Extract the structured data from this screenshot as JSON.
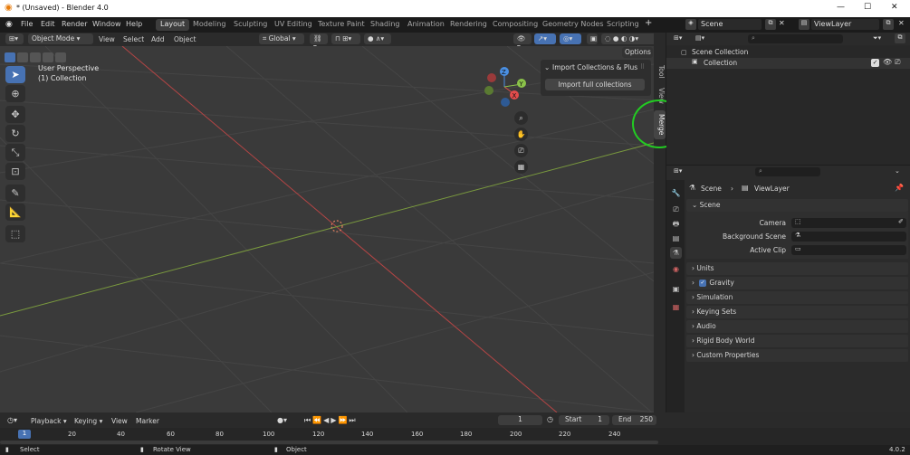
{
  "window": {
    "title": "* (Unsaved) - Blender 4.0",
    "minimize": "—",
    "maximize": "☐",
    "close": "✕"
  },
  "menu": [
    "File",
    "Edit",
    "Render",
    "Window",
    "Help"
  ],
  "workspaces": [
    "Layout",
    "Modeling",
    "Sculpting",
    "UV Editing",
    "Texture Paint",
    "Shading",
    "Animation",
    "Rendering",
    "Compositing",
    "Geometry Nodes",
    "Scripting"
  ],
  "active_workspace": "Layout",
  "add_tab": "+",
  "scene_field": "Scene",
  "viewlayer_field": "ViewLayer",
  "viewport_header": {
    "mode": "Object Mode",
    "menus": [
      "View",
      "Select",
      "Add",
      "Object"
    ],
    "orientation": "Global",
    "options": "Options"
  },
  "viewport": {
    "perspective": "User Perspective",
    "collection": "(1) Collection"
  },
  "gizmo": {
    "z": "Z",
    "y": "Y",
    "x": "X"
  },
  "sidebar_tabs": [
    "Tool",
    "View",
    "Merge"
  ],
  "import_panel": {
    "title": "Import Collections & Plus",
    "button": "Import full collections"
  },
  "outliner": {
    "scene_collection": "Scene Collection",
    "collection": "Collection"
  },
  "properties": {
    "breadcrumb_scene": "Scene",
    "breadcrumb_viewlayer": "ViewLayer",
    "scene_panel": "Scene",
    "camera_label": "Camera",
    "background_label": "Background Scene",
    "clip_label": "Active Clip",
    "panels": [
      "Units",
      "Gravity",
      "Simulation",
      "Keying Sets",
      "Audio",
      "Rigid Body World",
      "Custom Properties"
    ]
  },
  "timeline": {
    "menus": [
      "Playback",
      "Keying",
      "View",
      "Marker"
    ],
    "current_frame": "1",
    "start_label": "Start",
    "start_value": "1",
    "end_label": "End",
    "end_value": "250",
    "ruler": [
      "1",
      "20",
      "40",
      "60",
      "80",
      "100",
      "120",
      "140",
      "160",
      "180",
      "200",
      "220",
      "240"
    ]
  },
  "statusbar": {
    "select": "Select",
    "rotate": "Rotate View",
    "object": "Object",
    "version": "4.0.2"
  },
  "colors": {
    "accent": "#4772b3",
    "x_axis": "#e24c4c",
    "y_axis": "#8bc34a",
    "z_axis": "#4a8fe2",
    "highlight_ring": "#22cc22"
  }
}
